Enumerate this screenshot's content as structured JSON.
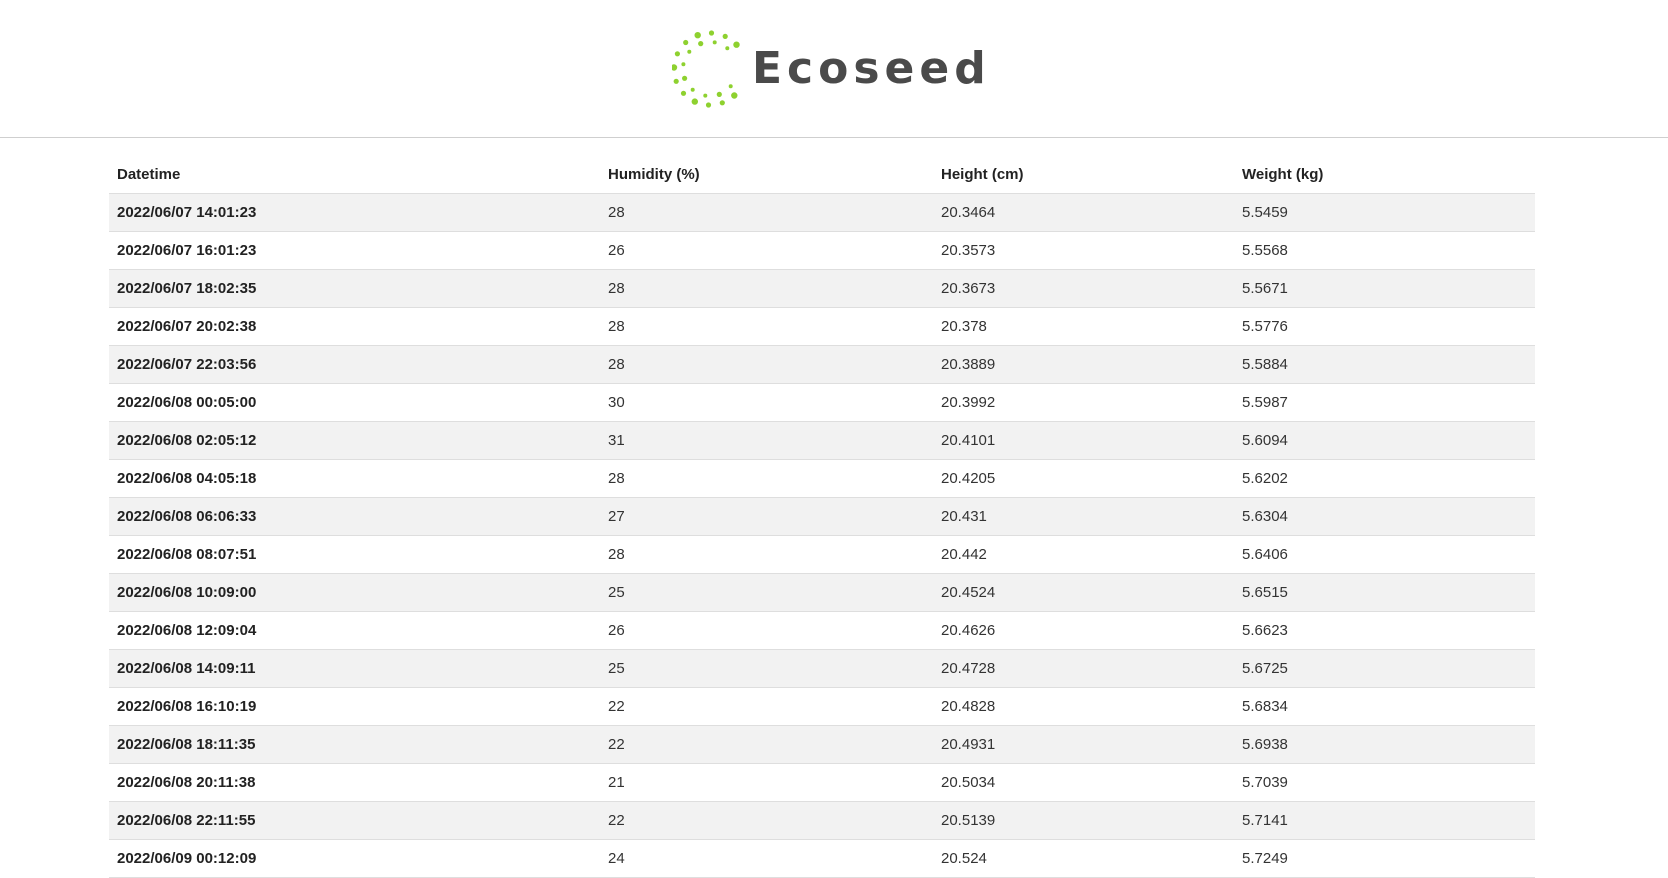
{
  "brand": {
    "name": "Ecoseed",
    "accent_color": "#8ed12f",
    "text_color": "#4a4a4a",
    "logo_icon": "dotted-circle-seed-icon"
  },
  "table": {
    "columns": [
      "Datetime",
      "Humidity (%)",
      "Height (cm)",
      "Weight (kg)"
    ],
    "rows": [
      [
        "2022/06/07 14:01:23",
        "28",
        "20.3464",
        "5.5459"
      ],
      [
        "2022/06/07 16:01:23",
        "26",
        "20.3573",
        "5.5568"
      ],
      [
        "2022/06/07 18:02:35",
        "28",
        "20.3673",
        "5.5671"
      ],
      [
        "2022/06/07 20:02:38",
        "28",
        "20.378",
        "5.5776"
      ],
      [
        "2022/06/07 22:03:56",
        "28",
        "20.3889",
        "5.5884"
      ],
      [
        "2022/06/08 00:05:00",
        "30",
        "20.3992",
        "5.5987"
      ],
      [
        "2022/06/08 02:05:12",
        "31",
        "20.4101",
        "5.6094"
      ],
      [
        "2022/06/08 04:05:18",
        "28",
        "20.4205",
        "5.6202"
      ],
      [
        "2022/06/08 06:06:33",
        "27",
        "20.431",
        "5.6304"
      ],
      [
        "2022/06/08 08:07:51",
        "28",
        "20.442",
        "5.6406"
      ],
      [
        "2022/06/08 10:09:00",
        "25",
        "20.4524",
        "5.6515"
      ],
      [
        "2022/06/08 12:09:04",
        "26",
        "20.4626",
        "5.6623"
      ],
      [
        "2022/06/08 14:09:11",
        "25",
        "20.4728",
        "5.6725"
      ],
      [
        "2022/06/08 16:10:19",
        "22",
        "20.4828",
        "5.6834"
      ],
      [
        "2022/06/08 18:11:35",
        "22",
        "20.4931",
        "5.6938"
      ],
      [
        "2022/06/08 20:11:38",
        "21",
        "20.5034",
        "5.7039"
      ],
      [
        "2022/06/08 22:11:55",
        "22",
        "20.5139",
        "5.7141"
      ],
      [
        "2022/06/09 00:12:09",
        "24",
        "20.524",
        "5.7249"
      ]
    ]
  }
}
